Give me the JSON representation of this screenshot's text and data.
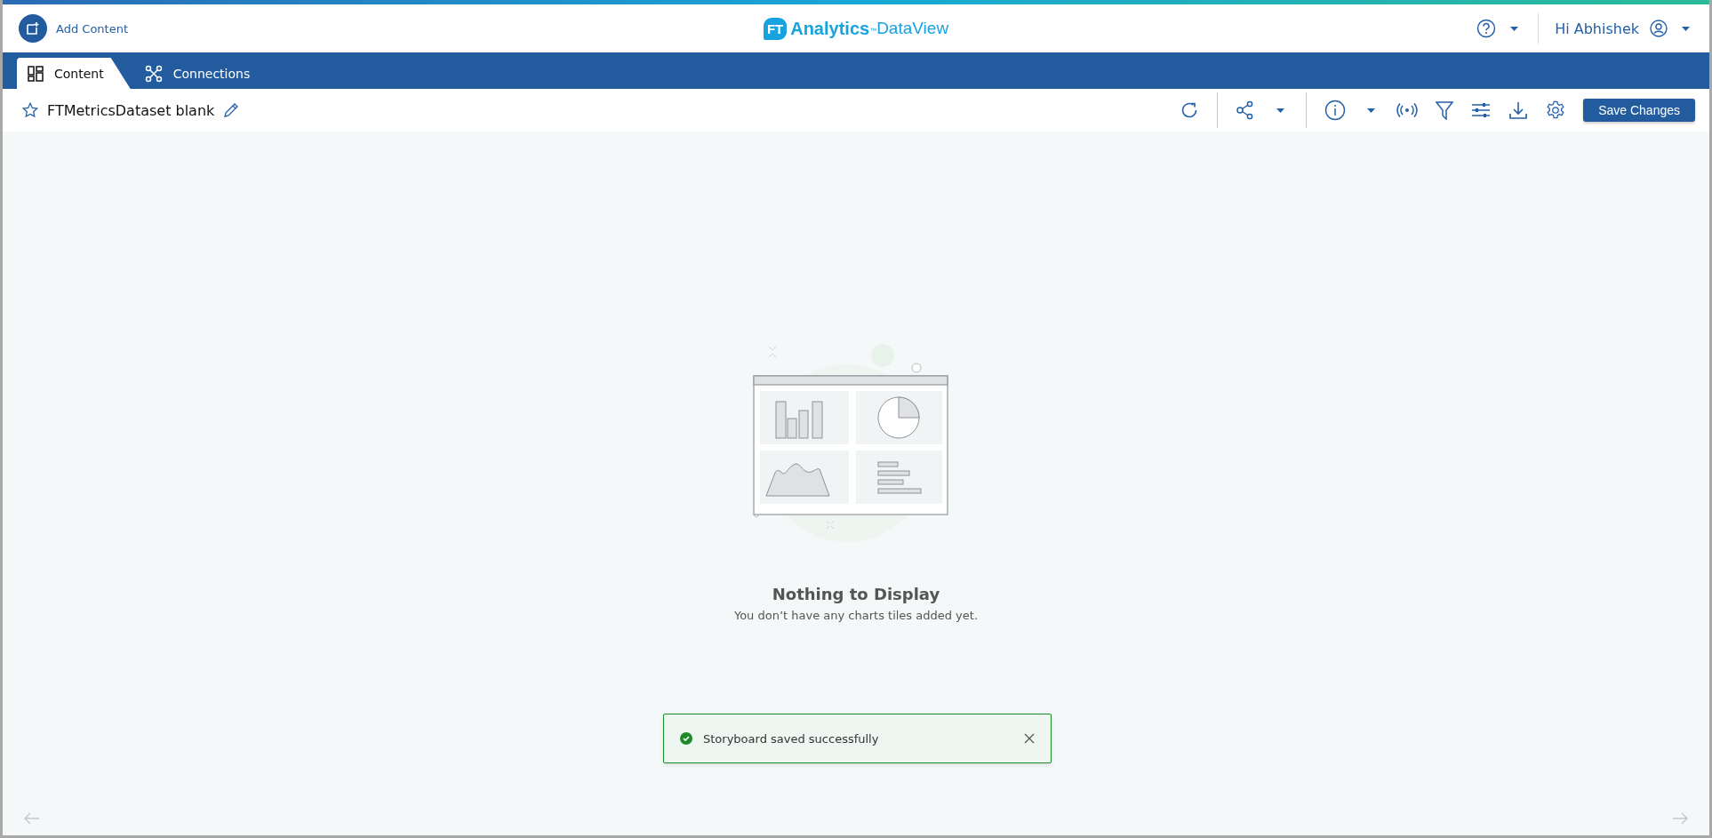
{
  "header": {
    "add_content": "Add Content",
    "logo": {
      "badge": "FT",
      "name": "Analytics",
      "mark": "™",
      "product": "DataView"
    },
    "greeting": "Hi Abhishek"
  },
  "tabs": [
    {
      "label": "Content",
      "kind": "content",
      "selected": true
    },
    {
      "label": "Connections",
      "kind": "connections",
      "selected": false
    }
  ],
  "storyboard": {
    "title": "FTMetricsDataset blank",
    "favorite": false,
    "save_button": "Save Changes"
  },
  "empty_state": {
    "title": "Nothing to Display",
    "message": "You don’t have any charts tiles added yet."
  },
  "toast": {
    "message": "Storyboard saved successfully",
    "kind": "success"
  }
}
